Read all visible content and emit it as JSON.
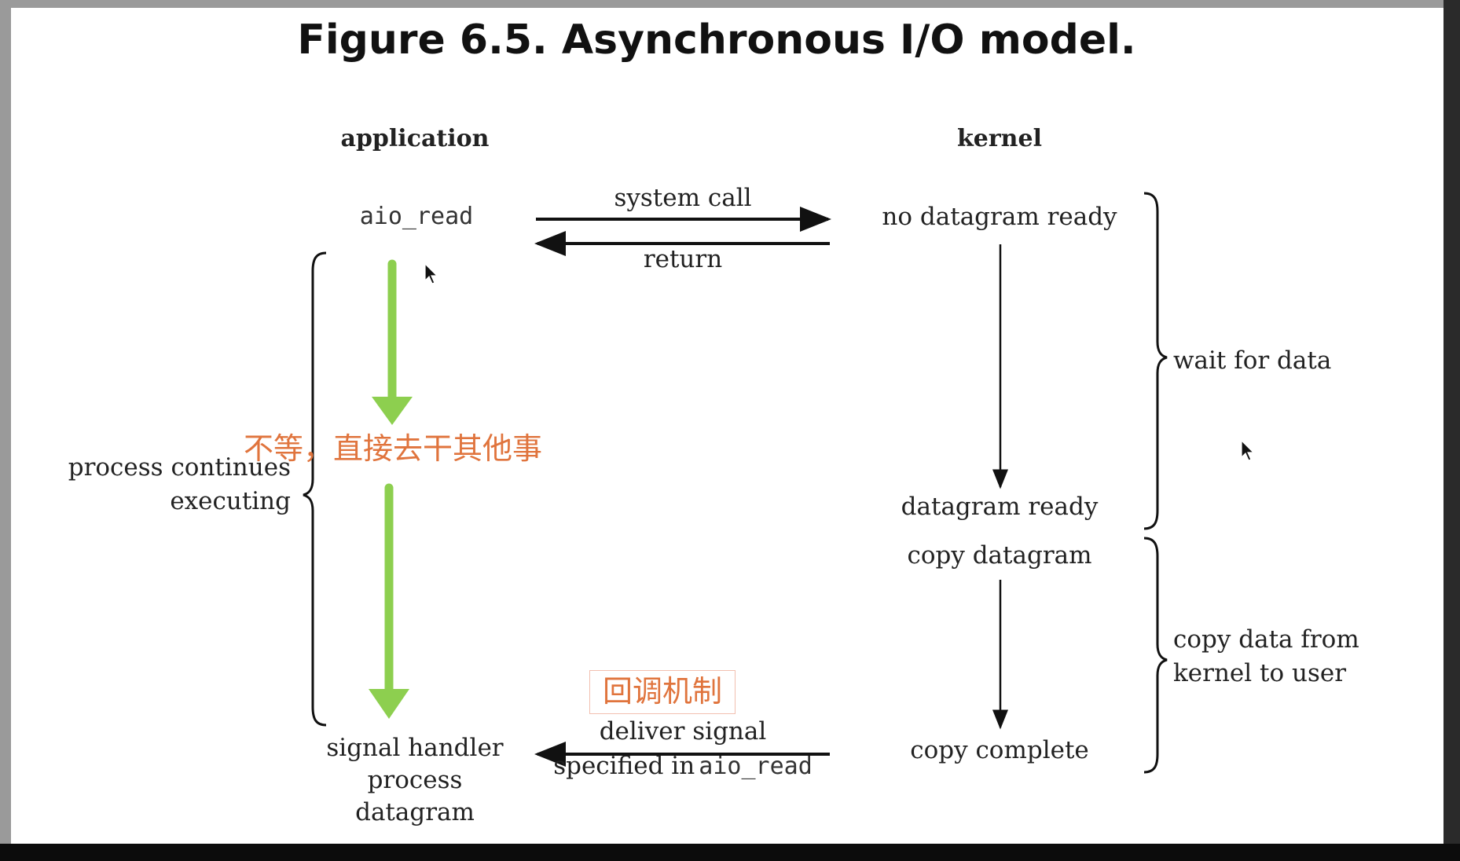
{
  "title": "Figure 6.5. Asynchronous I/O model.",
  "columns": {
    "application": "application",
    "kernel": "kernel"
  },
  "application": {
    "aio_read": "aio_read",
    "process_continues": [
      "process continues",
      "executing"
    ],
    "signal_handler": [
      "signal handler",
      "process",
      "datagram"
    ]
  },
  "arrows": {
    "system_call": "system call",
    "return": "return",
    "deliver_signal": "deliver signal",
    "specified_in_prefix": "specified in",
    "specified_in_code": "aio_read"
  },
  "kernel": {
    "no_datagram_ready": "no datagram ready",
    "datagram_ready": "datagram ready",
    "copy_datagram": "copy datagram",
    "copy_complete": "copy complete"
  },
  "phases": {
    "wait_for_data": "wait for data",
    "copy_data": [
      "copy data from",
      "kernel to user"
    ]
  },
  "annotations": {
    "no_wait": "不等，直接去干其他事",
    "callback": "回调机制"
  },
  "colors": {
    "annotation": "#e0743d",
    "green_arrow": "#8dcf4f",
    "line": "#111111"
  }
}
